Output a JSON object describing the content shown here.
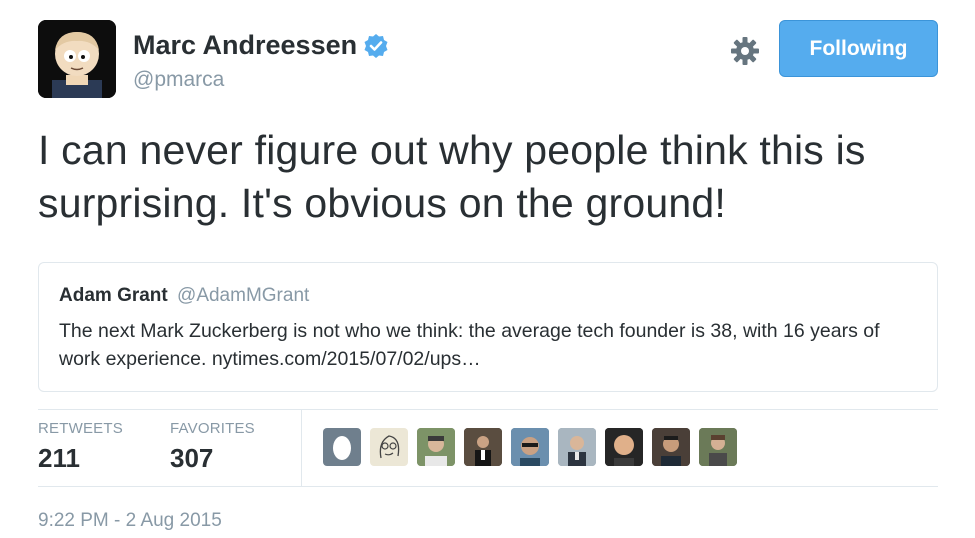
{
  "author": {
    "name": "Marc Andreessen",
    "handle": "@pmarca",
    "verified": true
  },
  "follow_button": {
    "label": "Following",
    "color": "#55acee"
  },
  "tweet": {
    "text": "I can never figure out why people think this is surprising. It's obvious on the ground!"
  },
  "quoted_tweet": {
    "name": "Adam Grant",
    "handle": "@AdamMGrant",
    "text": "The next Mark Zuckerberg is not who we think: the average tech founder is 38, with 16 years of work experience. nytimes.com/2015/07/02/ups…"
  },
  "stats": {
    "retweets_label": "RETWEETS",
    "retweets_value": "211",
    "favorites_label": "FAVORITES",
    "favorites_value": "307"
  },
  "favoriters": [
    {
      "icon": "default-egg-avatar"
    },
    {
      "icon": "sketch-avatar"
    },
    {
      "icon": "photo-avatar"
    },
    {
      "icon": "photo-avatar"
    },
    {
      "icon": "photo-avatar"
    },
    {
      "icon": "photo-avatar"
    },
    {
      "icon": "photo-avatar"
    },
    {
      "icon": "photo-avatar"
    },
    {
      "icon": "photo-avatar"
    }
  ],
  "timestamp": "9:22 PM - 2 Aug 2015"
}
